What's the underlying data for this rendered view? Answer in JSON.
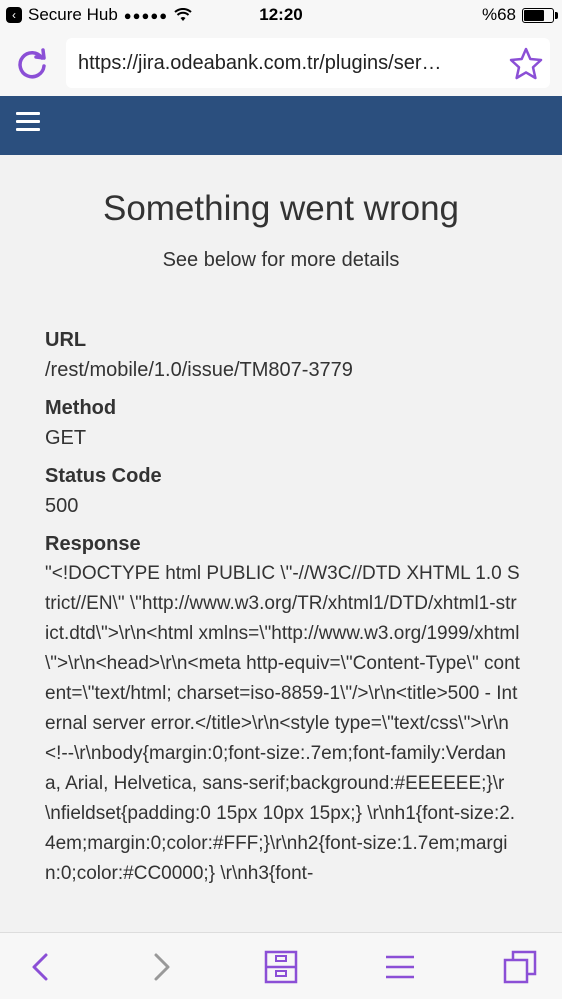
{
  "status_bar": {
    "carrier": "Secure Hub",
    "signal": "●●●●●",
    "time": "12:20",
    "battery_percent": "%68",
    "battery_level": 0.68
  },
  "browser": {
    "url": "https://jira.odeabank.com.tr/plugins/ser…",
    "accent_color": "#8b4fd6"
  },
  "header": {
    "bg_color": "#2b4f7e"
  },
  "error": {
    "title": "Something went wrong",
    "subtitle": "See below for more details",
    "url_label": "URL",
    "url_value": "/rest/mobile/1.0/issue/TM807-3779",
    "method_label": "Method",
    "method_value": "GET",
    "status_label": "Status Code",
    "status_value": "500",
    "response_label": "Response",
    "response_value": "\"<!DOCTYPE html PUBLIC \\\"-//W3C//DTD XHTML 1.0 Strict//EN\\\" \\\"http://www.w3.org/TR/xhtml1/DTD/xhtml1-strict.dtd\\\">\\r\\n<html xmlns=\\\"http://www.w3.org/1999/xhtml\\\">\\r\\n<head>\\r\\n<meta http-equiv=\\\"Content-Type\\\" content=\\\"text/html; charset=iso-8859-1\\\"/>\\r\\n<title>500 - Internal server error.</title>\\r\\n<style type=\\\"text/css\\\">\\r\\n<!--\\r\\nbody{margin:0;font-size:.7em;font-family:Verdana, Arial, Helvetica, sans-serif;background:#EEEEEE;}\\r\\nfieldset{padding:0 15px 10px 15px;} \\r\\nh1{font-size:2.4em;margin:0;color:#FFF;}\\r\\nh2{font-size:1.7em;margin:0;color:#CC0000;} \\r\\nh3{font-"
  },
  "toolbar": {
    "icons": [
      "back-icon",
      "forward-icon",
      "save-icon",
      "menu-icon",
      "tabs-icon"
    ]
  }
}
